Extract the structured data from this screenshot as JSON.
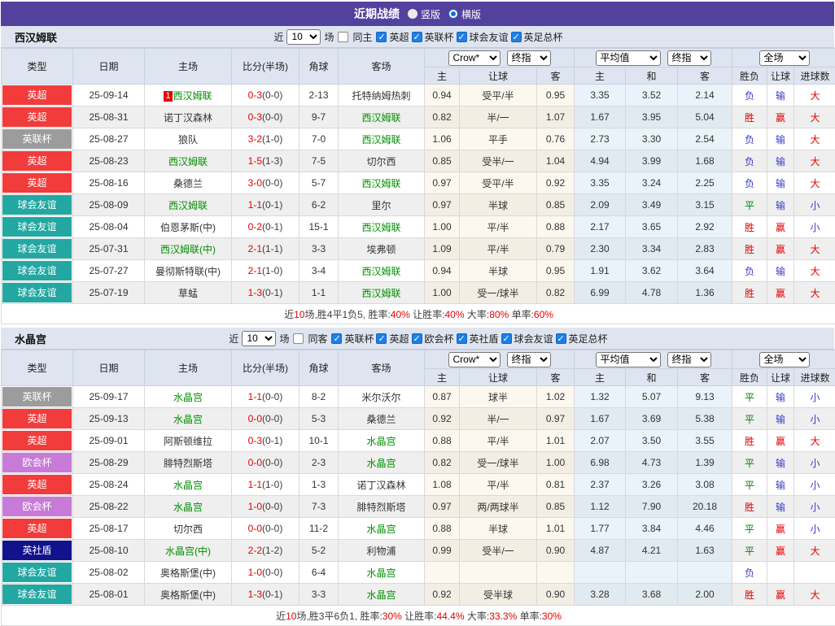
{
  "colors": {
    "topbar": "#53419e",
    "panel_bg": "#dfe5f0",
    "team_green": "#009000",
    "score_red": "#e60000",
    "result_red": "#e60000",
    "result_green": "#008000",
    "result_blue": "#3a3ace",
    "checkbox_blue": "#1e7fe6",
    "badge": {
      "英超": "#f23b3b",
      "英联杯": "#9c9c9c",
      "球会友谊": "#23a7a2",
      "欧会杯": "#c77ad8",
      "英社盾": "#12128c"
    }
  },
  "topbar": {
    "title": "近期战绩",
    "radios": [
      {
        "label": "竖版",
        "checked": false
      },
      {
        "label": "横版",
        "checked": true
      }
    ]
  },
  "filter_labels": {
    "near": "近",
    "count": "10",
    "unit": "场"
  },
  "selects": {
    "odds": "Crow*",
    "odds_stage": "终指",
    "avg": "平均值",
    "avg_stage": "终指",
    "scope": "全场"
  },
  "table_headers": {
    "type": "类型",
    "date": "日期",
    "home": "主场",
    "score": "比分(半场)",
    "corner": "角球",
    "away": "客场",
    "sub": [
      "主",
      "让球",
      "客",
      "主",
      "和",
      "客",
      "胜负",
      "让球",
      "进球数"
    ]
  },
  "sections": [
    {
      "team": "西汉姆联",
      "same_option": {
        "label": "同主",
        "checked": false
      },
      "leagues": [
        {
          "label": "英超",
          "checked": true
        },
        {
          "label": "英联杯",
          "checked": true
        },
        {
          "label": "球会友谊",
          "checked": true
        },
        {
          "label": "英足总杯",
          "checked": true
        }
      ],
      "rows": [
        {
          "type": "英超",
          "date": "25-09-14",
          "home": "西汉姆联",
          "home_green": true,
          "home_mark": "1",
          "score": "0-3",
          "half": "(0-0)",
          "corner": "2-13",
          "away": "托特纳姆热刺",
          "away_green": false,
          "let_home": "0.94",
          "handicap": "受平/半",
          "let_away": "0.95",
          "avg_home": "3.35",
          "avg_draw": "3.52",
          "avg_away": "2.14",
          "res": [
            [
              "负",
              "blue"
            ],
            [
              "输",
              "blue"
            ],
            [
              "大",
              "red"
            ]
          ]
        },
        {
          "type": "英超",
          "date": "25-08-31",
          "home": "诺丁汉森林",
          "home_green": false,
          "score": "0-3",
          "half": "(0-0)",
          "corner": "9-7",
          "away": "西汉姆联",
          "away_green": true,
          "let_home": "0.82",
          "handicap": "半/一",
          "let_away": "1.07",
          "avg_home": "1.67",
          "avg_draw": "3.95",
          "avg_away": "5.04",
          "res": [
            [
              "胜",
              "red"
            ],
            [
              "赢",
              "red"
            ],
            [
              "大",
              "red"
            ]
          ]
        },
        {
          "type": "英联杯",
          "date": "25-08-27",
          "home": "狼队",
          "home_green": false,
          "score": "3-2",
          "half": "(1-0)",
          "corner": "7-0",
          "away": "西汉姆联",
          "away_green": true,
          "let_home": "1.06",
          "handicap": "平手",
          "let_away": "0.76",
          "avg_home": "2.73",
          "avg_draw": "3.30",
          "avg_away": "2.54",
          "res": [
            [
              "负",
              "blue"
            ],
            [
              "输",
              "blue"
            ],
            [
              "大",
              "red"
            ]
          ]
        },
        {
          "type": "英超",
          "date": "25-08-23",
          "home": "西汉姆联",
          "home_green": true,
          "score": "1-5",
          "half": "(1-3)",
          "corner": "7-5",
          "away": "切尔西",
          "away_green": false,
          "let_home": "0.85",
          "handicap": "受半/一",
          "let_away": "1.04",
          "avg_home": "4.94",
          "avg_draw": "3.99",
          "avg_away": "1.68",
          "res": [
            [
              "负",
              "blue"
            ],
            [
              "输",
              "blue"
            ],
            [
              "大",
              "red"
            ]
          ]
        },
        {
          "type": "英超",
          "date": "25-08-16",
          "home": "桑德兰",
          "home_green": false,
          "score": "3-0",
          "half": "(0-0)",
          "corner": "5-7",
          "away": "西汉姆联",
          "away_green": true,
          "let_home": "0.97",
          "handicap": "受平/半",
          "let_away": "0.92",
          "avg_home": "3.35",
          "avg_draw": "3.24",
          "avg_away": "2.25",
          "res": [
            [
              "负",
              "blue"
            ],
            [
              "输",
              "blue"
            ],
            [
              "大",
              "red"
            ]
          ]
        },
        {
          "type": "球会友谊",
          "date": "25-08-09",
          "home": "西汉姆联",
          "home_green": true,
          "score": "1-1",
          "half": "(0-1)",
          "corner": "6-2",
          "away": "里尔",
          "away_green": false,
          "let_home": "0.97",
          "handicap": "半球",
          "let_away": "0.85",
          "avg_home": "2.09",
          "avg_draw": "3.49",
          "avg_away": "3.15",
          "res": [
            [
              "平",
              "green"
            ],
            [
              "输",
              "blue"
            ],
            [
              "小",
              "blue"
            ]
          ]
        },
        {
          "type": "球会友谊",
          "date": "25-08-04",
          "home": "伯恩茅斯(中)",
          "home_green": false,
          "score": "0-2",
          "half": "(0-1)",
          "corner": "15-1",
          "away": "西汉姆联",
          "away_green": true,
          "let_home": "1.00",
          "handicap": "平/半",
          "let_away": "0.88",
          "avg_home": "2.17",
          "avg_draw": "3.65",
          "avg_away": "2.92",
          "res": [
            [
              "胜",
              "red"
            ],
            [
              "赢",
              "red"
            ],
            [
              "小",
              "blue"
            ]
          ]
        },
        {
          "type": "球会友谊",
          "date": "25-07-31",
          "home": "西汉姆联(中)",
          "home_green": true,
          "score": "2-1",
          "half": "(1-1)",
          "corner": "3-3",
          "away": "埃弗顿",
          "away_green": false,
          "let_home": "1.09",
          "handicap": "平/半",
          "let_away": "0.79",
          "avg_home": "2.30",
          "avg_draw": "3.34",
          "avg_away": "2.83",
          "res": [
            [
              "胜",
              "red"
            ],
            [
              "赢",
              "red"
            ],
            [
              "大",
              "red"
            ]
          ]
        },
        {
          "type": "球会友谊",
          "date": "25-07-27",
          "home": "曼彻斯特联(中)",
          "home_green": false,
          "score": "2-1",
          "half": "(1-0)",
          "corner": "3-4",
          "away": "西汉姆联",
          "away_green": true,
          "let_home": "0.94",
          "handicap": "半球",
          "let_away": "0.95",
          "avg_home": "1.91",
          "avg_draw": "3.62",
          "avg_away": "3.64",
          "res": [
            [
              "负",
              "blue"
            ],
            [
              "输",
              "blue"
            ],
            [
              "大",
              "red"
            ]
          ]
        },
        {
          "type": "球会友谊",
          "date": "25-07-19",
          "home": "草蜢",
          "home_green": false,
          "score": "1-3",
          "half": "(0-1)",
          "corner": "1-1",
          "away": "西汉姆联",
          "away_green": true,
          "let_home": "1.00",
          "handicap": "受一/球半",
          "let_away": "0.82",
          "avg_home": "6.99",
          "avg_draw": "4.78",
          "avg_away": "1.36",
          "res": [
            [
              "胜",
              "red"
            ],
            [
              "赢",
              "red"
            ],
            [
              "大",
              "red"
            ]
          ]
        }
      ],
      "summary": [
        {
          "text": "近"
        },
        {
          "text": "10",
          "red": true
        },
        {
          "text": "场,胜4平1负5, 胜率:"
        },
        {
          "text": "40%",
          "red": true
        },
        {
          "text": " 让胜率:"
        },
        {
          "text": "40%",
          "red": true
        },
        {
          "text": " 大率:"
        },
        {
          "text": "80%",
          "red": true
        },
        {
          "text": " 单率:"
        },
        {
          "text": "60%",
          "red": true
        }
      ]
    },
    {
      "team": "水晶宫",
      "same_option": {
        "label": "同客",
        "checked": false
      },
      "leagues": [
        {
          "label": "英联杯",
          "checked": true
        },
        {
          "label": "英超",
          "checked": true
        },
        {
          "label": "欧会杯",
          "checked": true
        },
        {
          "label": "英社盾",
          "checked": true
        },
        {
          "label": "球会友谊",
          "checked": true
        },
        {
          "label": "英足总杯",
          "checked": true
        }
      ],
      "rows": [
        {
          "type": "英联杯",
          "date": "25-09-17",
          "home": "水晶宫",
          "home_green": true,
          "score": "1-1",
          "half": "(0-0)",
          "corner": "8-2",
          "away": "米尔沃尔",
          "away_green": false,
          "let_home": "0.87",
          "handicap": "球半",
          "let_away": "1.02",
          "avg_home": "1.32",
          "avg_draw": "5.07",
          "avg_away": "9.13",
          "res": [
            [
              "平",
              "green"
            ],
            [
              "输",
              "blue"
            ],
            [
              "小",
              "blue"
            ]
          ]
        },
        {
          "type": "英超",
          "date": "25-09-13",
          "home": "水晶宫",
          "home_green": true,
          "score": "0-0",
          "half": "(0-0)",
          "corner": "5-3",
          "away": "桑德兰",
          "away_green": false,
          "let_home": "0.92",
          "handicap": "半/一",
          "let_away": "0.97",
          "avg_home": "1.67",
          "avg_draw": "3.69",
          "avg_away": "5.38",
          "res": [
            [
              "平",
              "green"
            ],
            [
              "输",
              "blue"
            ],
            [
              "小",
              "blue"
            ]
          ]
        },
        {
          "type": "英超",
          "date": "25-09-01",
          "home": "阿斯顿维拉",
          "home_green": false,
          "score": "0-3",
          "half": "(0-1)",
          "corner": "10-1",
          "away": "水晶宫",
          "away_green": true,
          "let_home": "0.88",
          "handicap": "平/半",
          "let_away": "1.01",
          "avg_home": "2.07",
          "avg_draw": "3.50",
          "avg_away": "3.55",
          "res": [
            [
              "胜",
              "red"
            ],
            [
              "赢",
              "red"
            ],
            [
              "大",
              "red"
            ]
          ]
        },
        {
          "type": "欧会杯",
          "date": "25-08-29",
          "home": "腓特烈斯塔",
          "home_green": false,
          "score": "0-0",
          "half": "(0-0)",
          "corner": "2-3",
          "away": "水晶宫",
          "away_green": true,
          "let_home": "0.82",
          "handicap": "受一/球半",
          "let_away": "1.00",
          "avg_home": "6.98",
          "avg_draw": "4.73",
          "avg_away": "1.39",
          "res": [
            [
              "平",
              "green"
            ],
            [
              "输",
              "blue"
            ],
            [
              "小",
              "blue"
            ]
          ]
        },
        {
          "type": "英超",
          "date": "25-08-24",
          "home": "水晶宫",
          "home_green": true,
          "score": "1-1",
          "half": "(1-0)",
          "corner": "1-3",
          "away": "诺丁汉森林",
          "away_green": false,
          "let_home": "1.08",
          "handicap": "平/半",
          "let_away": "0.81",
          "avg_home": "2.37",
          "avg_draw": "3.26",
          "avg_away": "3.08",
          "res": [
            [
              "平",
              "green"
            ],
            [
              "输",
              "blue"
            ],
            [
              "小",
              "blue"
            ]
          ]
        },
        {
          "type": "欧会杯",
          "date": "25-08-22",
          "home": "水晶宫",
          "home_green": true,
          "score": "1-0",
          "half": "(0-0)",
          "corner": "7-3",
          "away": "腓特烈斯塔",
          "away_green": false,
          "let_home": "0.97",
          "handicap": "两/两球半",
          "let_away": "0.85",
          "avg_home": "1.12",
          "avg_draw": "7.90",
          "avg_away": "20.18",
          "res": [
            [
              "胜",
              "red"
            ],
            [
              "输",
              "blue"
            ],
            [
              "小",
              "blue"
            ]
          ]
        },
        {
          "type": "英超",
          "date": "25-08-17",
          "home": "切尔西",
          "home_green": false,
          "score": "0-0",
          "half": "(0-0)",
          "corner": "11-2",
          "away": "水晶宫",
          "away_green": true,
          "let_home": "0.88",
          "handicap": "半球",
          "let_away": "1.01",
          "avg_home": "1.77",
          "avg_draw": "3.84",
          "avg_away": "4.46",
          "res": [
            [
              "平",
              "green"
            ],
            [
              "赢",
              "red"
            ],
            [
              "小",
              "blue"
            ]
          ]
        },
        {
          "type": "英社盾",
          "date": "25-08-10",
          "home": "水晶宫(中)",
          "home_green": true,
          "score": "2-2",
          "half": "(1-2)",
          "corner": "5-2",
          "away": "利物浦",
          "away_green": false,
          "let_home": "0.99",
          "handicap": "受半/一",
          "let_away": "0.90",
          "avg_home": "4.87",
          "avg_draw": "4.21",
          "avg_away": "1.63",
          "res": [
            [
              "平",
              "green"
            ],
            [
              "赢",
              "red"
            ],
            [
              "大",
              "red"
            ]
          ]
        },
        {
          "type": "球会友谊",
          "date": "25-08-02",
          "home": "奥格斯堡(中)",
          "home_green": false,
          "score": "1-0",
          "half": "(0-0)",
          "corner": "6-4",
          "away": "水晶宫",
          "away_green": true,
          "let_home": "",
          "handicap": "",
          "let_away": "",
          "avg_home": "",
          "avg_draw": "",
          "avg_away": "",
          "res": [
            [
              "负",
              "blue"
            ],
            [
              "",
              ""
            ],
            [
              "",
              ""
            ]
          ]
        },
        {
          "type": "球会友谊",
          "date": "25-08-01",
          "home": "奥格斯堡(中)",
          "home_green": false,
          "score": "1-3",
          "half": "(0-1)",
          "corner": "3-3",
          "away": "水晶宫",
          "away_green": true,
          "let_home": "0.92",
          "handicap": "受半球",
          "let_away": "0.90",
          "avg_home": "3.28",
          "avg_draw": "3.68",
          "avg_away": "2.00",
          "res": [
            [
              "胜",
              "red"
            ],
            [
              "赢",
              "red"
            ],
            [
              "大",
              "red"
            ]
          ]
        }
      ],
      "summary": [
        {
          "text": "近"
        },
        {
          "text": "10",
          "red": true
        },
        {
          "text": "场,胜3平6负1, 胜率:"
        },
        {
          "text": "30%",
          "red": true
        },
        {
          "text": " 让胜率:"
        },
        {
          "text": "44.4%",
          "red": true
        },
        {
          "text": " 大率:"
        },
        {
          "text": "33.3%",
          "red": true
        },
        {
          "text": " 单率:"
        },
        {
          "text": "30%",
          "red": true
        }
      ]
    }
  ]
}
